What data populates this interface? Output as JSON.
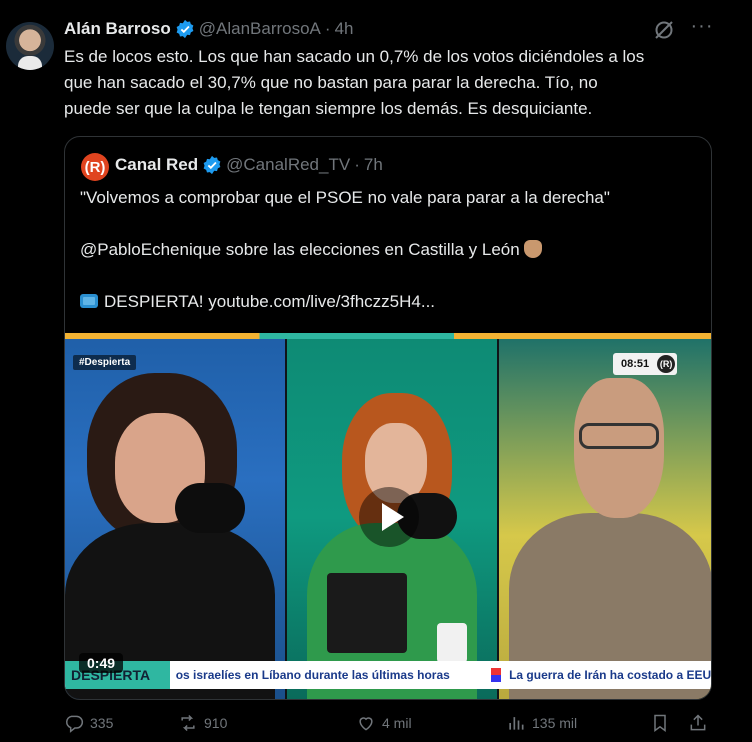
{
  "tweet": {
    "author_name": "Alán Barroso",
    "handle": "@AlanBarrosoA",
    "separator": "·",
    "time": "4h",
    "text": "Es de locos esto. Los que han sacado un 0,7% de los votos diciéndoles a los\nque han sacado el 30,7% que no bastan para parar la derecha. Tío, no\npuede ser que la culpa le tengan siempre los demás. Es desquiciante.",
    "more_label": "···"
  },
  "quote": {
    "avatar_label": "(R)",
    "author_name": "Canal Red",
    "handle": "@CanalRed_TV",
    "separator": "·",
    "time": "7h",
    "line1": "\"Volvemos a comprobar que el PSOE no vale para parar a la derecha\"",
    "line2": "@PabloEchenique sobre las elecciones en Castilla y León",
    "line3": "DESPIERTA! youtube.com/live/3fhczz5H4...",
    "video": {
      "tag": "#Despierta",
      "clock": "08:51",
      "clock_logo": "(R)",
      "duration": "0:49",
      "ticker_brand": "DESPIERTA",
      "ticker_a": "os israelíes en Líbano durante las últimas horas",
      "ticker_b": "La guerra de Irán ha costado a EEUU"
    }
  },
  "actions": {
    "replies": "335",
    "reposts": "910",
    "likes": "4 mil",
    "views": "135 mil"
  },
  "colors": {
    "background": "#000000",
    "text": "#e7e9ea",
    "muted": "#71767b",
    "verified": "#1d9bf0",
    "border": "#2f3336"
  },
  "icons": [
    "verified-badge-icon",
    "grok-icon",
    "more-icon",
    "reply-icon",
    "repost-icon",
    "like-icon",
    "views-icon",
    "bookmark-icon",
    "share-icon",
    "play-icon",
    "tv-icon",
    "pointing-hand-icon"
  ]
}
